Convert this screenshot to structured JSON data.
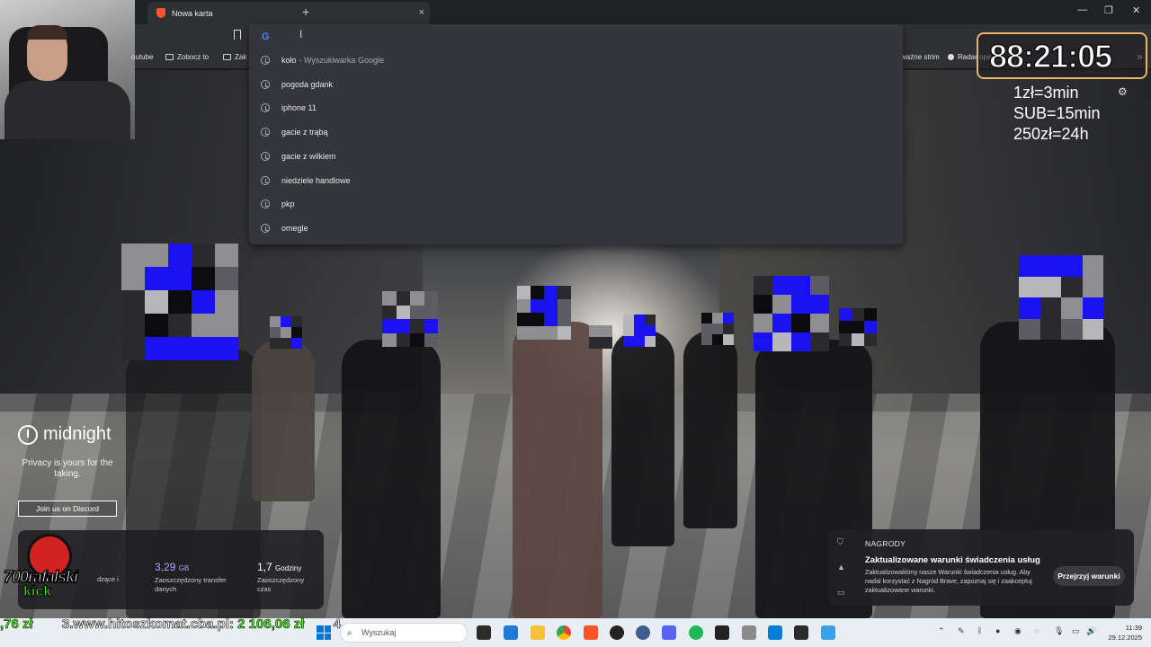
{
  "browser": {
    "tab_title": "Nowa karta",
    "tab_close": "×",
    "new_tab": "+",
    "window_controls": [
      "—",
      "❐",
      "✕"
    ]
  },
  "bookmarks": [
    {
      "label": "outube",
      "icon": "youtube-icon"
    },
    {
      "label": "Zobocz to",
      "icon": "folder-icon"
    },
    {
      "label": "Zak",
      "icon": "folder-icon"
    },
    {
      "label": "ważne strim",
      "icon": "none"
    },
    {
      "label": "Radar ope",
      "icon": "none"
    },
    {
      "label": "»",
      "icon": "more-icon"
    }
  ],
  "omnibox": {
    "provider_icon": "G",
    "caret": "I"
  },
  "suggestions": [
    {
      "text": "koło",
      "suffix": "- Wyszukiwarka Google"
    },
    {
      "text": "pogoda gdank",
      "suffix": ""
    },
    {
      "text": "iphone 11",
      "suffix": ""
    },
    {
      "text": "gacie z trąbą",
      "suffix": ""
    },
    {
      "text": "gacie z wilkiem",
      "suffix": ""
    },
    {
      "text": "niedziele handlowe",
      "suffix": ""
    },
    {
      "text": "pkp",
      "suffix": ""
    },
    {
      "text": "omegle",
      "suffix": ""
    }
  ],
  "overlay": {
    "timer": "88:21:05",
    "rates": [
      "1zł=3min",
      "SUB=15min",
      "250zł=24h"
    ]
  },
  "midnight": {
    "logo": "midnight",
    "tagline": "Privacy is yours for the taking.",
    "discord_button": "Join us on Discord"
  },
  "stats": {
    "left_fragment": "dzące i",
    "transfer_value": "3,29",
    "transfer_unit": "GB",
    "transfer_label": "Zaoszczędzony transfer danych",
    "time_value": "1,7",
    "time_unit": "Godziny",
    "time_label": "Zaoszczędzony czas"
  },
  "kick": {
    "name": "700rafalski",
    "platform": "kick"
  },
  "notification": {
    "category": "NAGRODY",
    "heading": "Zaktualizowane warunki świadczenia usług",
    "body": "Zaktualizowaliśmy nasze Warunki świadczenia usług. Aby nadal korzystać z Nagród Brave, zapoznaj się i zaakceptuj zaktualizowane warunki.",
    "button": "Przejrzyj warunki"
  },
  "ticker": {
    "left_amount": ",76 zł",
    "site": "3.www.hitoszkomat.cba.pl:",
    "amount": "2 106,06 zł",
    "next": "4"
  },
  "taskbar": {
    "search_placeholder": "Wyszukaj",
    "time": "11:39",
    "date": "29.12.2025"
  },
  "colors": {
    "accent_orange": "#fb542b",
    "kick_green": "#53fc18",
    "mosaic_blue": "#1a12f0",
    "timer_border": "#e8b36a"
  }
}
